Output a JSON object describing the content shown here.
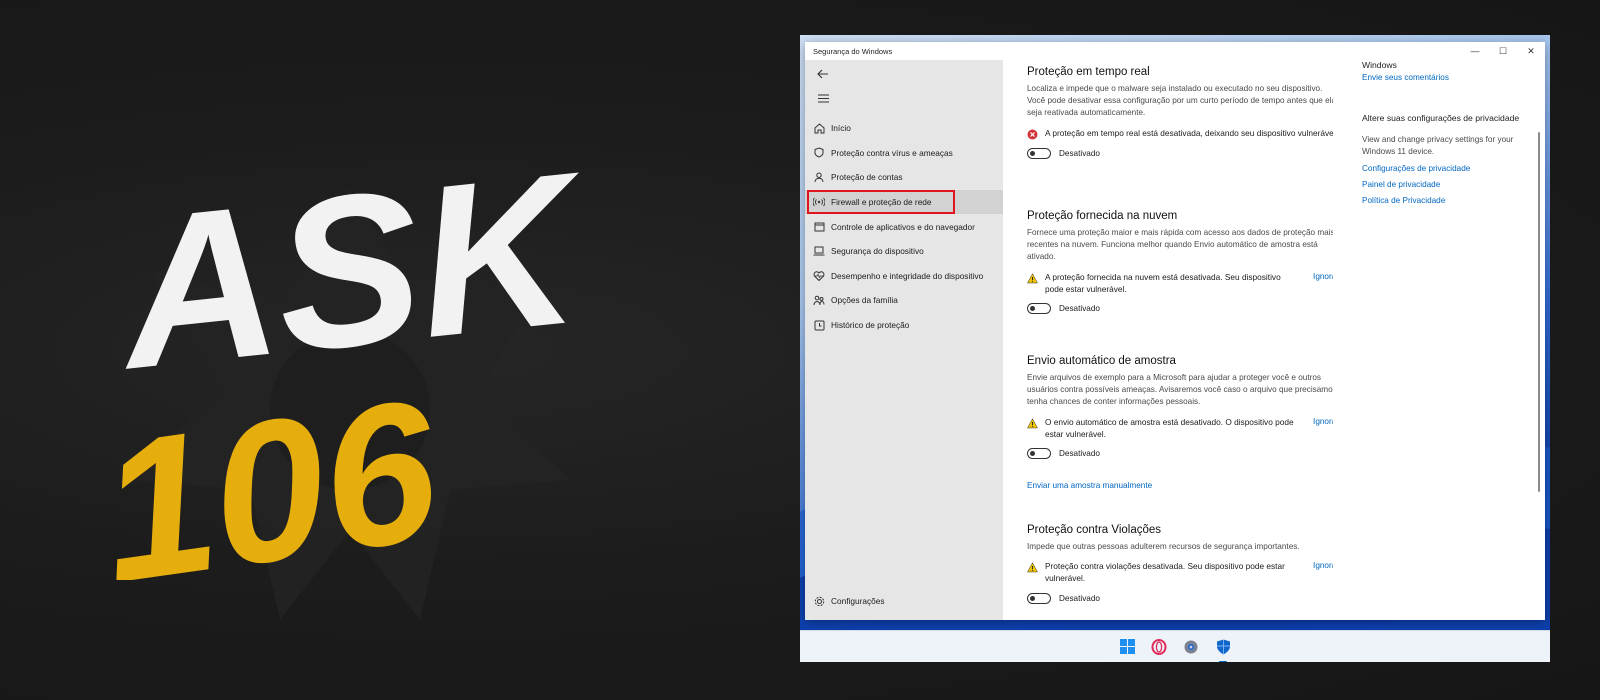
{
  "brand": {
    "word": "ASK",
    "number": "106",
    "colors": {
      "word": "#f2f2f2",
      "number": "#e6ae0c"
    }
  },
  "window": {
    "title": "Segurança do Windows",
    "controls": [
      "minimize-icon",
      "maximize-icon",
      "close-icon"
    ]
  },
  "sidebar": {
    "back_icon": "back-arrow-icon",
    "menu_icon": "hamburger-icon",
    "items": [
      {
        "label": "Início",
        "icon": "home-icon"
      },
      {
        "label": "Proteção contra vírus e ameaças",
        "icon": "shield-icon"
      },
      {
        "label": "Proteção de contas",
        "icon": "person-icon"
      },
      {
        "label": "Firewall e proteção de rede",
        "icon": "antenna-icon",
        "selected": true
      },
      {
        "label": "Controle de aplicativos e do navegador",
        "icon": "app-window-icon"
      },
      {
        "label": "Segurança do dispositivo",
        "icon": "laptop-icon"
      },
      {
        "label": "Desempenho e integridade do dispositivo",
        "icon": "heart-pulse-icon"
      },
      {
        "label": "Opções da família",
        "icon": "family-icon"
      },
      {
        "label": "Histórico de proteção",
        "icon": "history-icon"
      }
    ],
    "settings": {
      "label": "Configurações",
      "icon": "gear-icon"
    }
  },
  "main": {
    "realtime": {
      "title": "Proteção em tempo real",
      "desc": "Localiza e impede que o malware seja instalado ou executado no seu dispositivo. Você pode desativar essa configuração por um curto período de tempo antes que ela seja reativada automaticamente.",
      "alert": "A proteção em tempo real está desativada, deixando seu dispositivo vulnerável.",
      "toggle": "Desativado"
    },
    "cloud": {
      "title": "Proteção fornecida na nuvem",
      "desc": "Fornece uma proteção maior e mais rápida com acesso aos dados de proteção mais recentes na nuvem. Funciona melhor quando Envio automático de amostra está ativado.",
      "alert": "A proteção fornecida na nuvem está desativada. Seu dispositivo pode estar vulnerável.",
      "ignore": "Ignorar",
      "toggle": "Desativado"
    },
    "sample": {
      "title": "Envio automático de amostra",
      "desc": "Envie arquivos de exemplo para a Microsoft para ajudar a proteger você e outros usuários contra possíveis ameaças. Avisaremos você caso o arquivo que precisamos tenha chances de conter informações pessoais.",
      "alert": "O envio automático de amostra está desativado. O dispositivo pode estar vulnerável.",
      "ignore": "Ignorar",
      "toggle": "Desativado",
      "manual_link": "Enviar uma amostra manualmente"
    },
    "tamper": {
      "title": "Proteção contra Violações",
      "desc": "Impede que outras pessoas adulterem recursos de segurança importantes.",
      "alert": "Proteção contra violações desativada. Seu dispositivo pode estar vulnerável.",
      "ignore": "Ignorar",
      "toggle": "Desativado"
    }
  },
  "right": {
    "windows_head": "Windows",
    "feedback_link": "Envie seus comentários",
    "privacy_head": "Altere suas configurações de privacidade",
    "privacy_body": "View and change privacy settings for your Windows 11 device.",
    "links": [
      "Configurações de privacidade",
      "Painel de privacidade",
      "Política de Privacidade"
    ]
  },
  "taskbar": {
    "icons": [
      "windows-start-icon",
      "opera-icon",
      "settings-icon",
      "windows-security-icon"
    ],
    "active": "windows-security-icon"
  }
}
